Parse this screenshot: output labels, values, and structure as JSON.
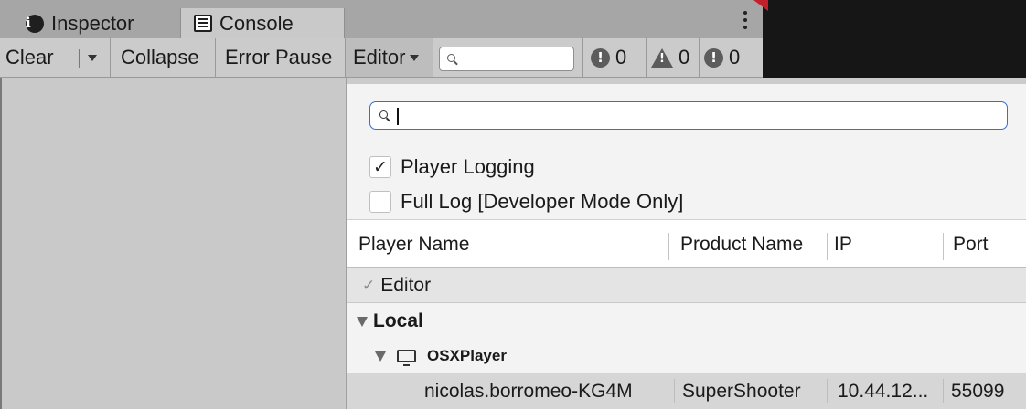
{
  "tabs": [
    {
      "label": "Inspector",
      "icon": "info-icon"
    },
    {
      "label": "Console",
      "icon": "console-icon"
    }
  ],
  "toolbar": {
    "clear": "Clear",
    "collapse": "Collapse",
    "error_pause": "Error Pause",
    "editor": "Editor",
    "search_placeholder": "",
    "error_count": "0",
    "warning_count": "0",
    "message_count": "0"
  },
  "popup": {
    "search_value": "",
    "options": [
      {
        "label": "Player Logging",
        "checked": true
      },
      {
        "label": "Full Log [Developer Mode Only]",
        "checked": false
      }
    ],
    "columns": {
      "player_name": "Player Name",
      "product_name": "Product Name",
      "ip": "IP",
      "port": "Port"
    },
    "rows": {
      "editor": {
        "check": "✓",
        "label": "Editor"
      },
      "local": {
        "label": "Local"
      },
      "osx": {
        "label": "OSXPlayer"
      },
      "player": {
        "name": "nicolas.borromeo-KG4M",
        "product": "SuperShooter",
        "ip": "10.44.12...",
        "port": "55099"
      }
    }
  },
  "colors": {
    "tab_bar": "#a6a6a6",
    "toolbar": "#cbcbcb",
    "popup_bg": "#f3f3f3",
    "search_focus": "#3a6fc4",
    "selected_row": "#d6d6d6",
    "dark_area": "#161616"
  }
}
